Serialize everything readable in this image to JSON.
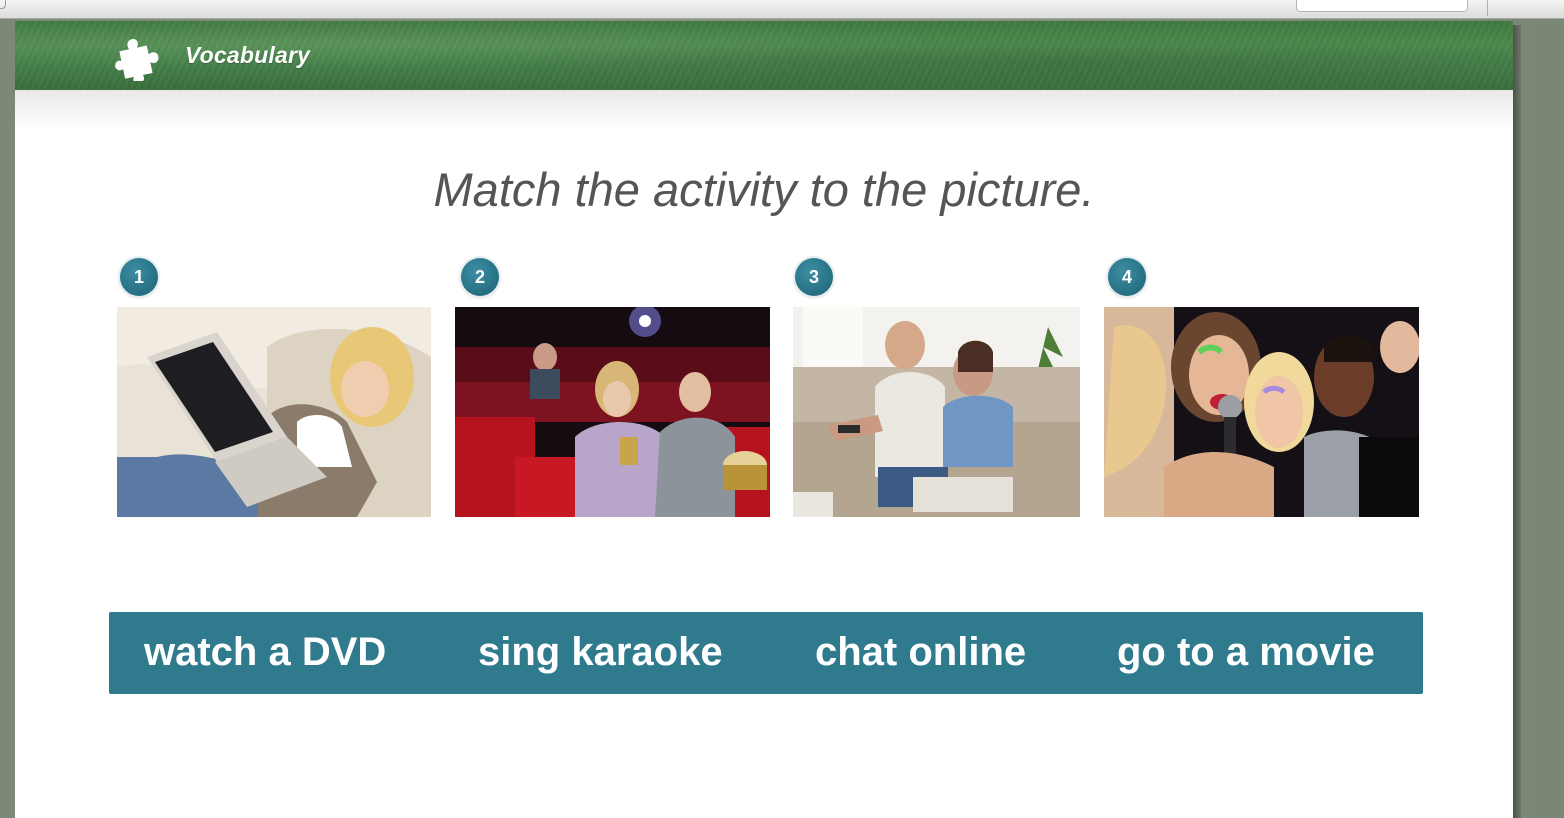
{
  "banner": {
    "title": "Vocabulary",
    "icon": "puzzle-piece-icon"
  },
  "instruction": "Match the activity to the picture.",
  "pictures": [
    {
      "number": "1",
      "depicts": "woman-with-laptop"
    },
    {
      "number": "2",
      "depicts": "couple-in-cinema"
    },
    {
      "number": "3",
      "depicts": "couple-on-sofa-with-remote"
    },
    {
      "number": "4",
      "depicts": "friends-singing-karaoke"
    }
  ],
  "word_bank": [
    "watch a DVD",
    "sing karaoke",
    "chat online",
    "go to a movie"
  ],
  "colors": {
    "banner_green": "#45804a",
    "badge_teal": "#2f7a8d",
    "word_bank_bg": "#2f7a8d",
    "instruction_text": "#555555"
  }
}
